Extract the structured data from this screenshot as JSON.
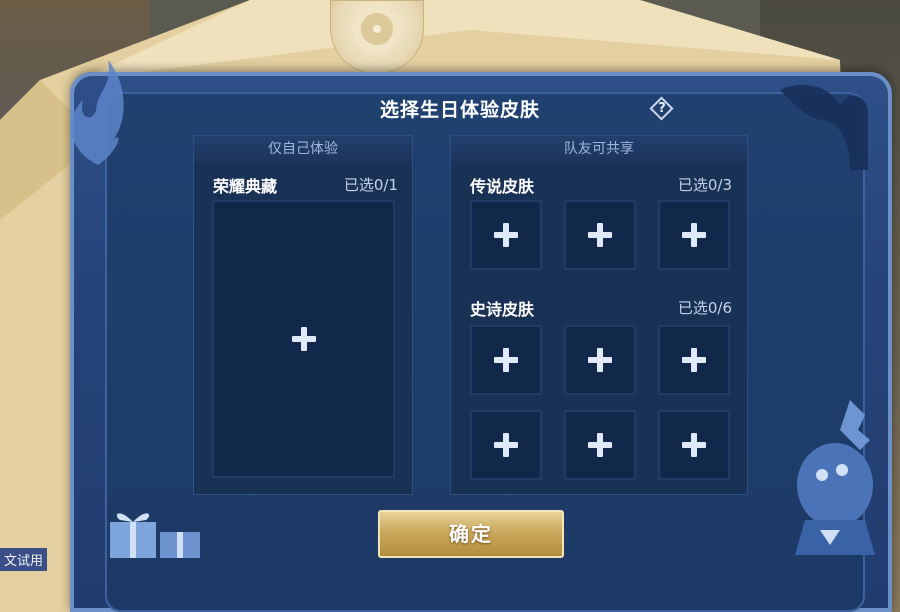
{
  "dialog": {
    "title": "选择生日体验皮肤",
    "help_icon": "question-diamond-icon",
    "confirm_label": "确定"
  },
  "self_panel": {
    "header": "仅自己体验",
    "section": {
      "title": "荣耀典藏",
      "count": "已选0/1"
    }
  },
  "team_panel": {
    "header": "队友可共享",
    "legend": {
      "title": "传说皮肤",
      "count": "已选0/3"
    },
    "epic": {
      "title": "史诗皮肤",
      "count": "已选0/6"
    }
  },
  "colors": {
    "card": "#26447a",
    "slot": "#11284b",
    "confirm": "#c9a85c",
    "envelope": "#e8d7ad"
  },
  "background": {
    "side_text": "文试用"
  }
}
